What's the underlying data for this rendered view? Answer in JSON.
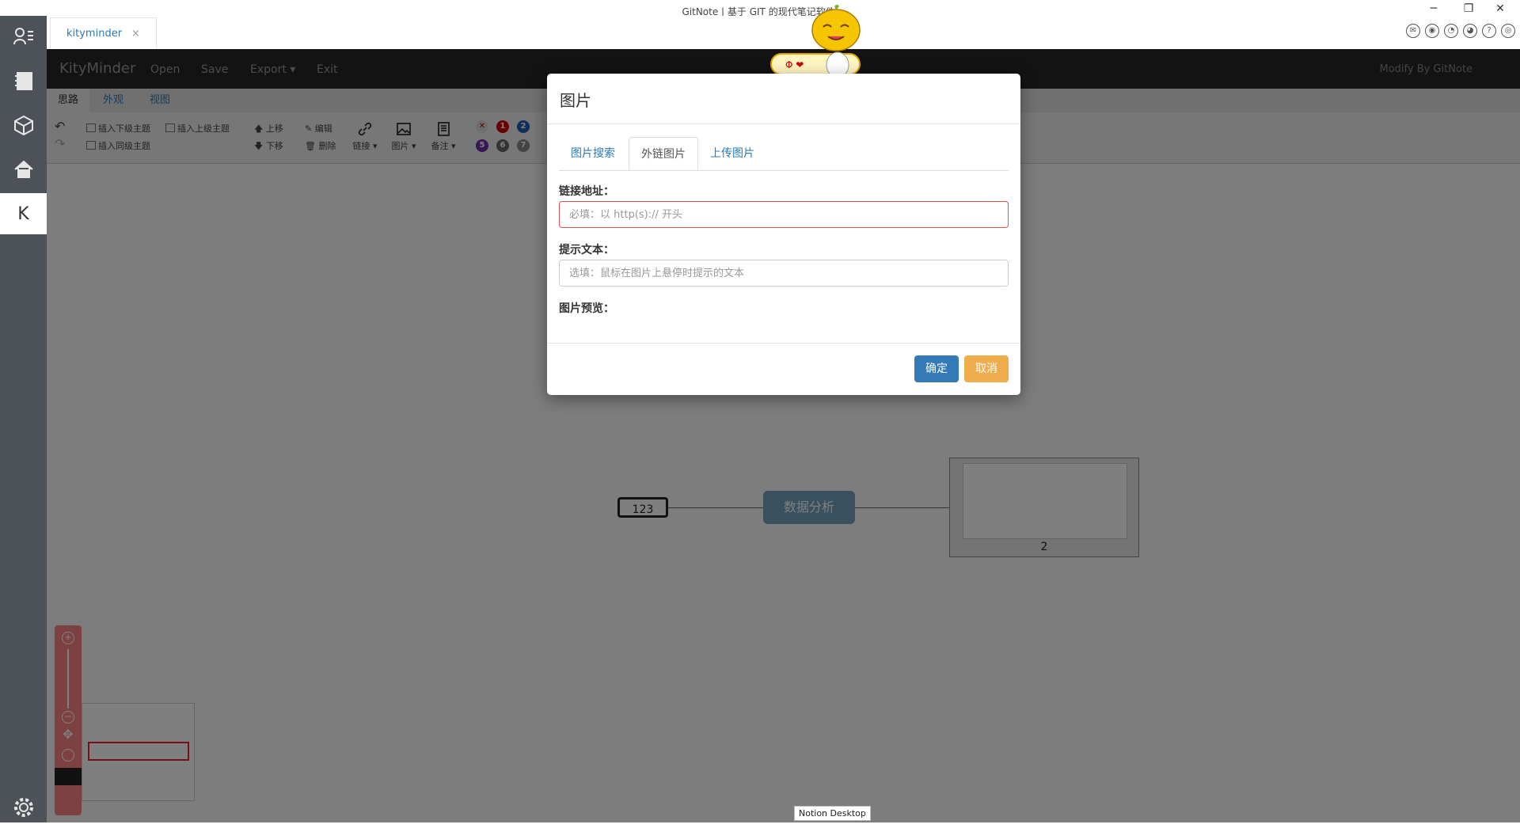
{
  "window": {
    "title": "GitNote | 基于 GIT 的现代笔记软件.",
    "minimize": "─",
    "restore": "❐",
    "close": "✕"
  },
  "tray_icons": [
    "wechat-icon",
    "weibo-icon",
    "qq-icon",
    "github-icon",
    "help-icon",
    "globe-icon"
  ],
  "tray_glyphs": [
    "✉",
    "◉",
    "◔",
    "◕",
    "?",
    "◎"
  ],
  "sidebar": {
    "items": [
      {
        "name": "user-list-icon"
      },
      {
        "name": "notebook-icon"
      },
      {
        "name": "box-icon"
      },
      {
        "name": "home-icon"
      },
      {
        "name": "kityminder-app",
        "label": "K"
      },
      {
        "name": "settings-icon"
      }
    ]
  },
  "doc_tab": {
    "label": "kityminder",
    "close": "×"
  },
  "appbar": {
    "brand": "KityMinder",
    "menus": [
      "Open",
      "Save",
      "Export ▾",
      "Exit"
    ],
    "modified_by": "Modify By GitNote"
  },
  "ribbon": {
    "tabs": [
      "思路",
      "外观",
      "视图"
    ],
    "insert_child": "插入下级主题",
    "insert_parent": "插入上级主题",
    "insert_sibling": "插入同级主题",
    "move_up": "上移",
    "move_down": "下移",
    "edit": "编辑",
    "delete": "删除",
    "link": "链接 ▾",
    "image": "图片 ▾",
    "note": "备注 ▾",
    "priorities_top": [
      "✕",
      "1",
      "2"
    ],
    "priorities_bottom": [
      "5",
      "6",
      "7"
    ]
  },
  "mindmap": {
    "left_node": "123",
    "main_node": "数据分析",
    "image_node_label": "2"
  },
  "notion_badge": "Notion Desktop",
  "modal": {
    "title": "图片",
    "tabs": [
      "图片搜索",
      "外链图片",
      "上传图片"
    ],
    "active_tab": 1,
    "url_label": "链接地址：",
    "url_placeholder": "必填：以 http(s):// 开头",
    "url_value": "",
    "tip_label": "提示文本：",
    "tip_placeholder": "选填：鼠标在图片上悬停时提示的文本",
    "tip_value": "",
    "preview_label": "图片预览：",
    "ok": "确定",
    "cancel": "取消"
  },
  "colors": {
    "sidebar": "#4c5257",
    "appbar": "#262626",
    "primary": "#337ab7",
    "warning": "#f0ad4e",
    "error_border": "#d9534f",
    "node_main": "#73a1bf",
    "zoom_panel": "#fc8383"
  }
}
